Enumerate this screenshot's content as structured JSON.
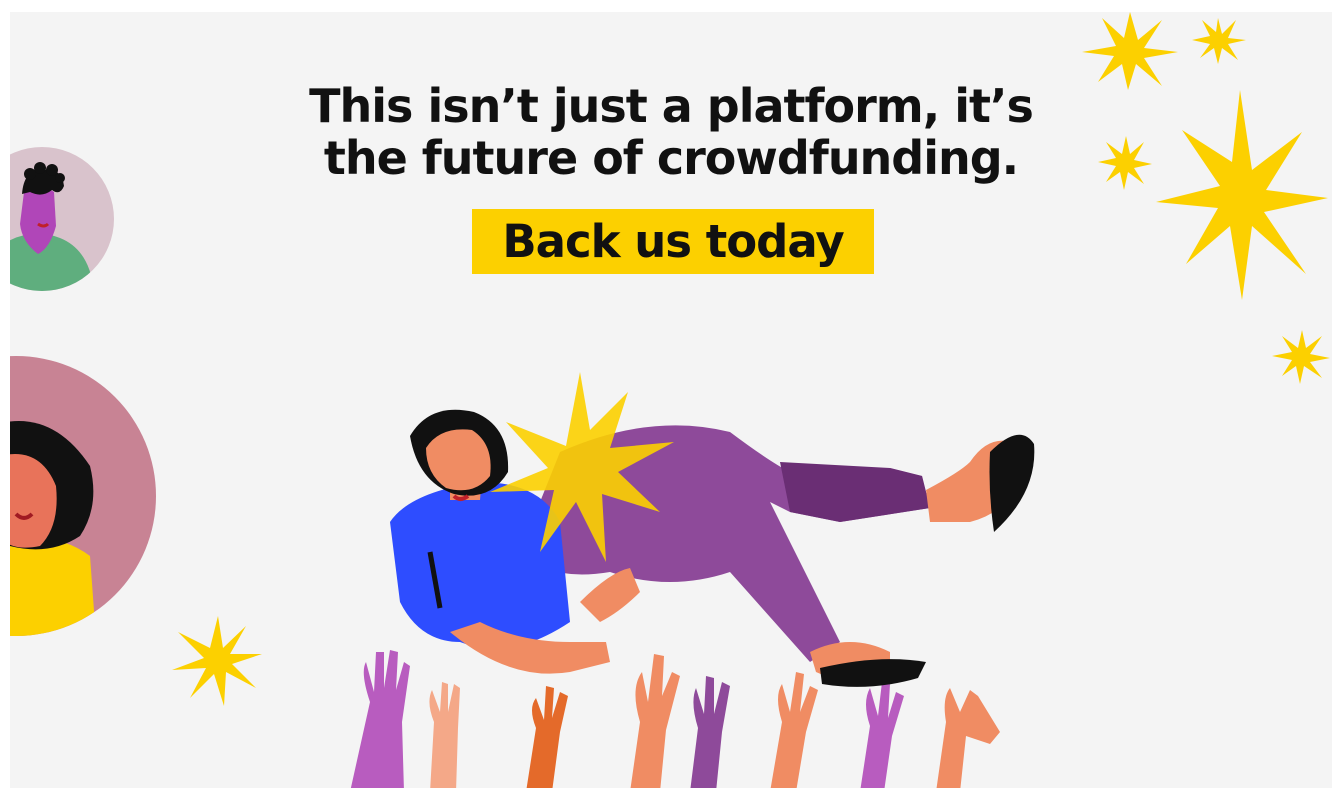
{
  "headline": {
    "line1": "This isn’t just a platform, it’s",
    "line2": "the future of crowdfunding."
  },
  "cta": {
    "label": "Back us today"
  },
  "colors": {
    "background": "#f4f4f4",
    "accent_yellow": "#fcd000",
    "text": "#111111",
    "shirt_blue": "#2e4dff",
    "pants_purple": "#8e4a9a",
    "skin": "#f08c63"
  }
}
